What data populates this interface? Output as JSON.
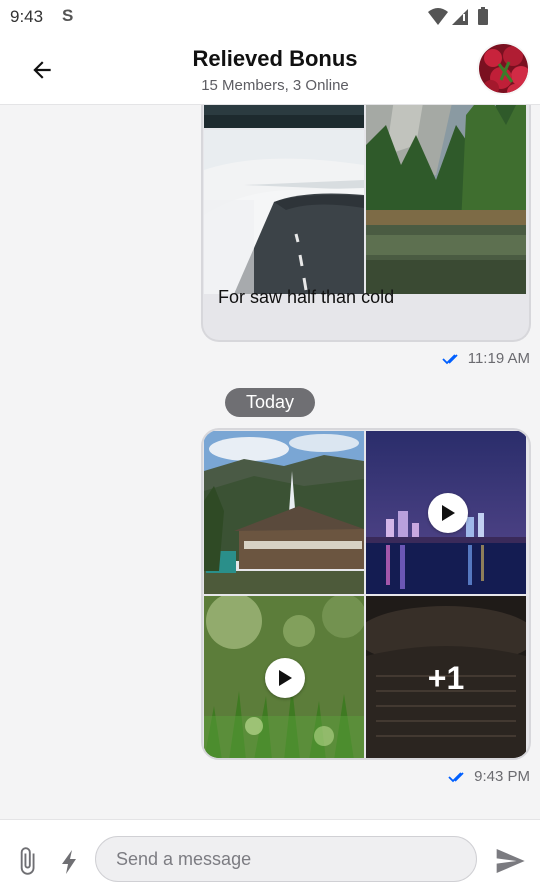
{
  "status_bar": {
    "time": "9:43",
    "app_indicator": "S",
    "icons": [
      "wifi-icon",
      "signal-icon",
      "battery-icon"
    ]
  },
  "header": {
    "title": "Relieved Bonus",
    "subtitle": "15 Members, 3 Online",
    "back_icon": "arrow-back-icon"
  },
  "messages": [
    {
      "caption": "For saw half than cold",
      "time": "11:19 AM",
      "status_icon": "double-check-icon",
      "images": [
        "snowy-road-image",
        "forest-lake-image"
      ]
    },
    {
      "time": "9:43 PM",
      "status_icon": "double-check-icon",
      "images": [
        "mountain-house-image",
        "city-night-video",
        "grass-bokeh-video",
        "book-pages-image"
      ],
      "more_count": "+1"
    }
  ],
  "date_separator": "Today",
  "composer": {
    "placeholder": "Send a message",
    "attach_icon": "paperclip-icon",
    "commands_icon": "lightning-icon",
    "send_icon": "send-icon"
  },
  "colors": {
    "accent": "#005fff",
    "bubble": "#e6e6ea",
    "date_pill": "#6f6f73"
  }
}
